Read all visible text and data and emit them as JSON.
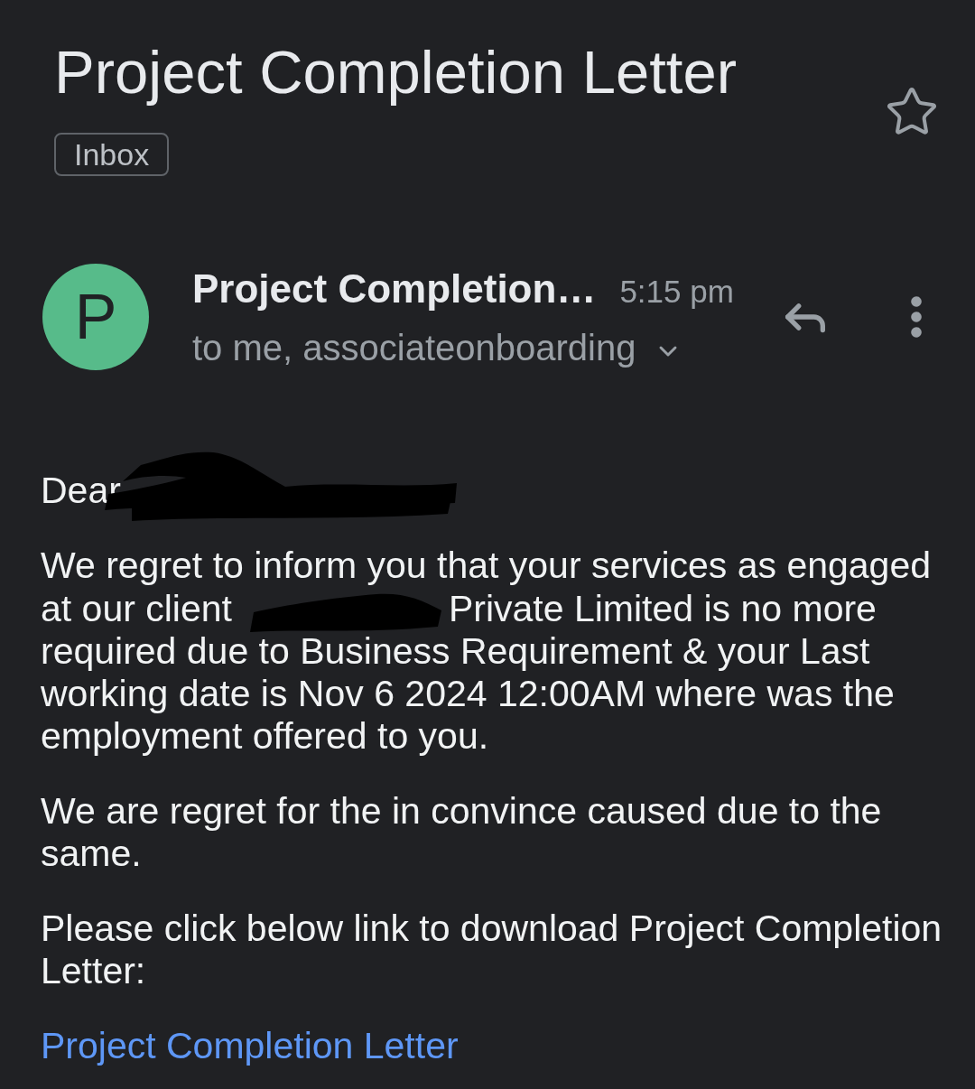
{
  "subject": {
    "title": "Project Completion Letter",
    "label": "Inbox",
    "starred": false
  },
  "message_header": {
    "avatar": {
      "letter": "P",
      "color": "#57bb8a"
    },
    "sender": "Project Completion…",
    "time": "5:15 pm",
    "recipients": "to me, associateonboarding",
    "details_expanded": false
  },
  "body": {
    "paragraphs": [
      {
        "rows": [
          [
            {
              "kind": "text",
              "text": "Dear"
            },
            {
              "kind": "redaction"
            }
          ]
        ]
      },
      {
        "rows": [
          [
            {
              "kind": "text",
              "text": "We regret to inform you that your services as engaged"
            }
          ],
          [
            {
              "kind": "text",
              "text": "at our client"
            },
            {
              "kind": "redaction"
            },
            {
              "kind": "text",
              "text": "Private Limited is no more"
            }
          ],
          [
            {
              "kind": "text",
              "text": "required due to Business Requirement & your Last working date is Nov 6 2024 12:00AM where was the employment offered to you."
            }
          ]
        ]
      },
      {
        "rows": [
          [
            {
              "kind": "text",
              "text": "We are regret for the in convince caused due to the same."
            }
          ]
        ]
      },
      {
        "rows": [
          [
            {
              "kind": "text",
              "text": "Please click below link to download Project Completion Letter:"
            }
          ]
        ]
      }
    ],
    "link": "Project Completion Letter"
  }
}
